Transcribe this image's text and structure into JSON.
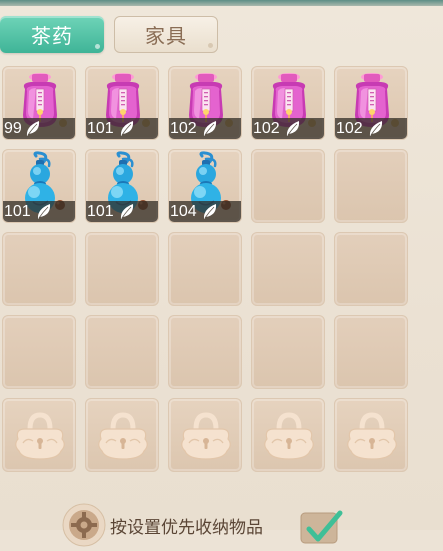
{
  "tabs": [
    {
      "label": "茶药",
      "active": true
    },
    {
      "label": "家具",
      "active": false
    }
  ],
  "accent_color": "#3fb497",
  "grid": {
    "rows": [
      [
        {
          "type": "potion-jar",
          "count": "99"
        },
        {
          "type": "potion-jar",
          "count": "101"
        },
        {
          "type": "potion-jar",
          "count": "102"
        },
        {
          "type": "potion-jar",
          "count": "102"
        },
        {
          "type": "potion-jar",
          "count": "102"
        }
      ],
      [
        {
          "type": "gourd",
          "count": "101"
        },
        {
          "type": "gourd",
          "count": "101"
        },
        {
          "type": "gourd",
          "count": "104"
        },
        {
          "type": "empty"
        },
        {
          "type": "empty"
        }
      ],
      [
        {
          "type": "empty"
        },
        {
          "type": "empty"
        },
        {
          "type": "empty"
        },
        {
          "type": "empty"
        },
        {
          "type": "empty"
        }
      ],
      [
        {
          "type": "empty"
        },
        {
          "type": "empty"
        },
        {
          "type": "empty"
        },
        {
          "type": "empty"
        },
        {
          "type": "empty"
        }
      ],
      [
        {
          "type": "locked"
        },
        {
          "type": "locked"
        },
        {
          "type": "locked"
        },
        {
          "type": "locked"
        },
        {
          "type": "locked"
        }
      ]
    ]
  },
  "bottom": {
    "label": "按设置优先收纳物品",
    "checked": true,
    "gear_icon": "gear-icon",
    "check_icon": "checkmark-icon"
  }
}
